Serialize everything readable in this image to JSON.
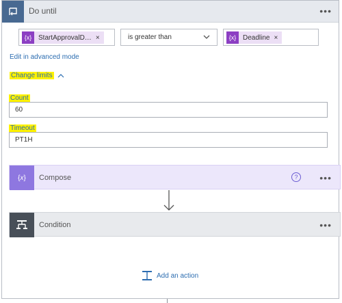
{
  "header": {
    "title": "Do until",
    "more_label": "•••"
  },
  "condition_row": {
    "left_token": {
      "icon": "{x}",
      "label": "StartApprovalD…",
      "remove": "×"
    },
    "operator": "is greater than",
    "right_token": {
      "icon": "{x}",
      "label": "Deadline",
      "remove": "×"
    }
  },
  "advanced_link": "Edit in advanced mode",
  "change_limits": "Change limits",
  "count": {
    "label": "Count",
    "value": "60"
  },
  "timeout": {
    "label": "Timeout",
    "value": "PT1H"
  },
  "compose": {
    "title": "Compose",
    "help": "?",
    "more_label": "•••"
  },
  "condition_step": {
    "title": "Condition",
    "more_label": "•••"
  },
  "add_action": "Add an action",
  "colors": {
    "header_bg": "#e6e9ee",
    "loop_icon_bg": "#486991",
    "token_bg": "#ecdff5",
    "token_icon_bg": "#8c3fc3",
    "link": "#2b6cb0",
    "highlight": "#fff200",
    "compose_bg": "#ece7fb",
    "compose_icon_bg": "#8e77e0",
    "condition_bg": "#e8eaed",
    "condition_icon_bg": "#484f58"
  },
  "icons": [
    "loop-icon",
    "variable-icon",
    "chevron-down-icon",
    "chevron-up-icon",
    "help-icon",
    "condition-icon",
    "arrow-down-icon",
    "add-action-icon"
  ]
}
